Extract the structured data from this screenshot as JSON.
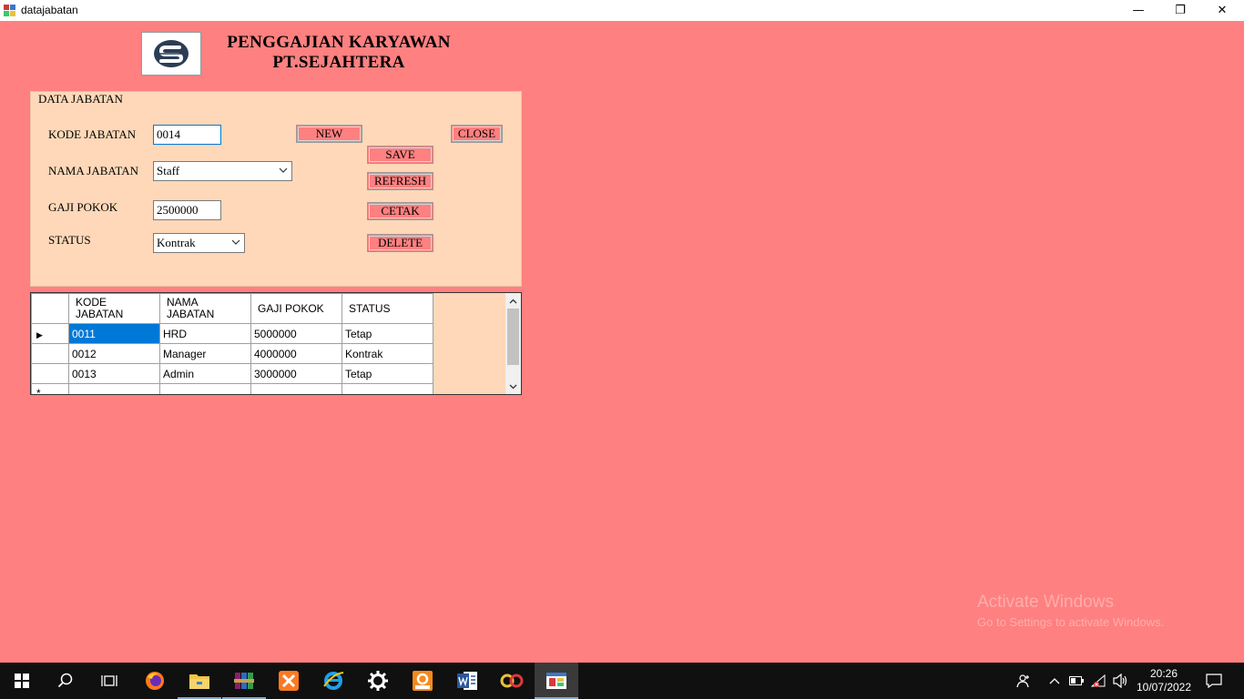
{
  "window": {
    "title": "datajabatan",
    "minimize_glyph": "—",
    "restore_glyph": "❐",
    "close_glyph": "✕"
  },
  "header": {
    "title_line1": "PENGGAJIAN KARYAWAN",
    "title_line2": "PT.SEJAHTERA"
  },
  "form": {
    "group_title": "DATA JABATAN",
    "kode_label": "KODE JABATAN",
    "kode_value": "0014",
    "nama_label": "NAMA JABATAN",
    "nama_value": "Staff",
    "gaji_label": "GAJI POKOK",
    "gaji_value": "2500000",
    "status_label": "STATUS",
    "status_value": "Kontrak"
  },
  "buttons": {
    "new": "NEW",
    "save": "SAVE",
    "refresh": "REFRESH",
    "cetak": "CETAK",
    "delete": "DELETE",
    "close": "CLOSE"
  },
  "grid": {
    "columns": [
      "KODE JABATAN",
      "NAMA JABATAN",
      "GAJI POKOK",
      "STATUS"
    ],
    "rows": [
      [
        "0011",
        "HRD",
        "5000000",
        "Tetap"
      ],
      [
        "0012",
        "Manager",
        "4000000",
        "Kontrak"
      ],
      [
        "0013",
        "Admin",
        "3000000",
        "Tetap"
      ]
    ],
    "current_row_marker": "▶",
    "new_row_marker": "*"
  },
  "watermark": {
    "line1": "Activate Windows",
    "line2": "Go to Settings to activate Windows."
  },
  "taskbar": {
    "clock_time": "20:26",
    "clock_date": "10/07/2022"
  },
  "colors": {
    "background": "#ff8080",
    "panel": "#fed8b8",
    "selection": "#0078d7",
    "taskbar": "#101010"
  }
}
